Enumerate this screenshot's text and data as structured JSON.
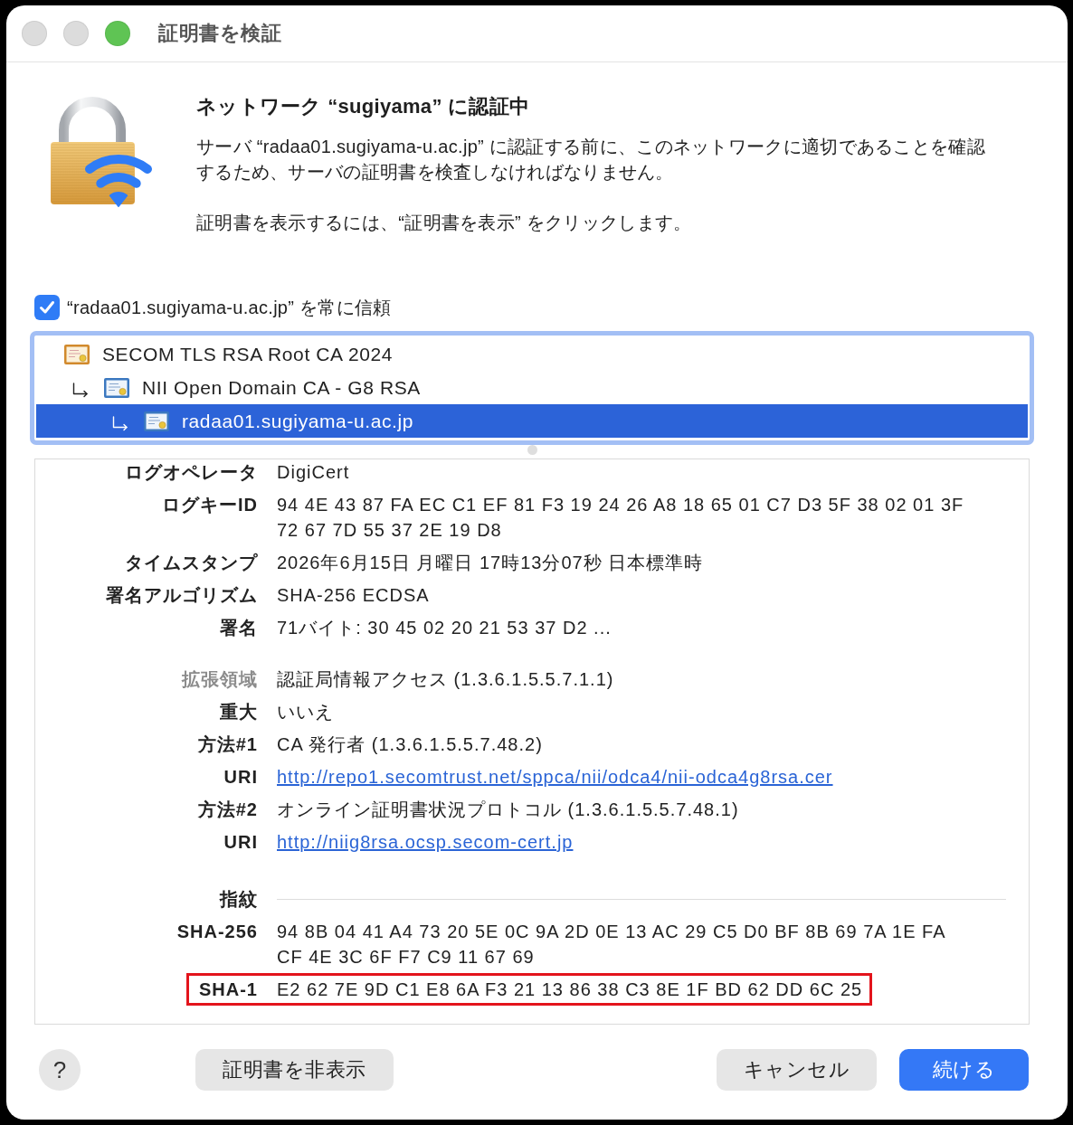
{
  "window": {
    "title": "証明書を検証",
    "controls": [
      {
        "kind": "close",
        "disabled": true
      },
      {
        "kind": "minimize",
        "disabled": true
      },
      {
        "kind": "zoom",
        "disabled": false
      }
    ]
  },
  "header": {
    "title": "ネットワーク “sugiyama” に認証中",
    "message": "サーバ “radaa01.sugiyama-u.ac.jp” に認証する前に、このネットワークに適切であることを確認するため、サーバの証明書を検査しなければなりません。",
    "hint": "証明書を表示するには、“証明書を表示” をクリックします。"
  },
  "trust_checkbox": {
    "label": "“radaa01.sugiyama-u.ac.jp” を常に信頼",
    "checked": true
  },
  "certificate_chain": [
    {
      "name": "SECOM TLS RSA Root CA 2024",
      "kind": "root",
      "selected": false,
      "children": [
        {
          "name": "NII Open Domain CA - G8 RSA",
          "kind": "intermediate",
          "selected": false,
          "children": [
            {
              "name": "radaa01.sugiyama-u.ac.jp",
              "kind": "leaf",
              "selected": true
            }
          ]
        }
      ]
    }
  ],
  "details": {
    "rows": [
      {
        "label": "ログオペレータ",
        "value": "DigiCert",
        "kind": "field",
        "highlighted": false
      },
      {
        "label": "ログキーID",
        "value": "94 4E 43 87 FA EC C1 EF 81 F3 19 24 26 A8 18 65 01 C7 D3 5F 38 02 01 3F 72 67 7D 55 37 2E 19 D8",
        "kind": "field",
        "highlighted": false
      },
      {
        "label": "タイムスタンプ",
        "value": "2026年6月15日 月曜日 17時13分07秒 日本標準時",
        "kind": "field",
        "highlighted": false
      },
      {
        "label": "署名アルゴリズム",
        "value": "SHA-256 ECDSA",
        "kind": "field",
        "highlighted": false
      },
      {
        "label": "署名",
        "value": "71バイト: 30 45 02 20 21 53 37 D2 ...",
        "kind": "field",
        "highlighted": false
      },
      {
        "label": "拡張領域",
        "value": "認証局情報アクセス (1.3.6.1.5.5.7.1.1)",
        "kind": "section",
        "highlighted": false
      },
      {
        "label": "重大",
        "value": "いいえ",
        "kind": "field",
        "highlighted": false
      },
      {
        "label": "方法#1",
        "value": "CA 発行者 (1.3.6.1.5.5.7.48.2)",
        "kind": "field",
        "highlighted": false
      },
      {
        "label": "URI",
        "value": "http://repo1.secomtrust.net/sppca/nii/odca4/nii-odca4g8rsa.cer",
        "kind": "link",
        "highlighted": false
      },
      {
        "label": "方法#2",
        "value": "オンライン証明書状況プロトコル (1.3.6.1.5.5.7.48.1)",
        "kind": "field",
        "highlighted": false
      },
      {
        "label": "URI",
        "value": "http://niig8rsa.ocsp.secom-cert.jp",
        "kind": "link",
        "highlighted": false
      },
      {
        "label": "指紋",
        "kind": "heading",
        "highlighted": false
      },
      {
        "label": "SHA-256",
        "value": "94 8B 04 41 A4 73 20 5E 0C 9A 2D 0E 13 AC 29 C5 D0 BF 8B 69 7A 1E FA CF 4E 3C 6F F7 C9 11 67 69",
        "kind": "field",
        "highlighted": false
      },
      {
        "label": "SHA-1",
        "value": "E2 62 7E 9D C1 E8 6A F3 21 13 86 38 C3 8E 1F BD 62 DD 6C 25",
        "kind": "field",
        "highlighted": true
      }
    ]
  },
  "footer": {
    "help": "?",
    "left_buttons": [
      {
        "label": "証明書を非表示",
        "kind": "normal"
      }
    ],
    "right_buttons": [
      {
        "label": "キャンセル",
        "kind": "normal"
      },
      {
        "label": "続ける",
        "kind": "default"
      }
    ]
  }
}
